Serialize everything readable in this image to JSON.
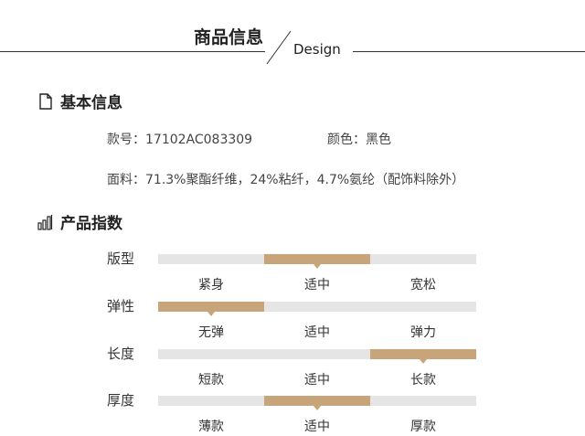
{
  "header": {
    "title": "商品信息",
    "subtitle": "Design"
  },
  "basic": {
    "heading": "基本信息",
    "style_no": "款号：17102AC083309",
    "color": "颜色：黑色",
    "material": "面料：71.3%聚酯纤维，24%粘纤，4.7%氨纶（配饰料除外）"
  },
  "index": {
    "heading": "产品指数",
    "accent_color": "#c8a47a",
    "track_color": "#e5e5e5",
    "rows": [
      {
        "label": "版型",
        "options": [
          "紧身",
          "适中",
          "宽松"
        ],
        "selected": 1
      },
      {
        "label": "弹性",
        "options": [
          "无弹",
          "适中",
          "弹力"
        ],
        "selected": 0
      },
      {
        "label": "长度",
        "options": [
          "短款",
          "适中",
          "长款"
        ],
        "selected": 2
      },
      {
        "label": "厚度",
        "options": [
          "薄款",
          "适中",
          "厚款"
        ],
        "selected": 1
      }
    ]
  }
}
